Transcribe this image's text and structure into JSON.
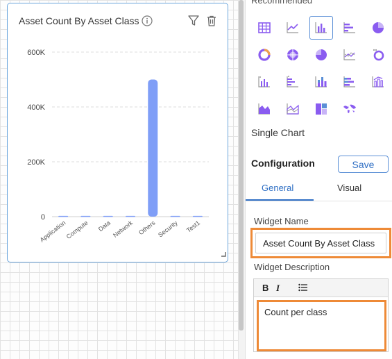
{
  "widget": {
    "title": "Asset Count By Asset Class",
    "icons": [
      "info-icon",
      "filter-icon",
      "trash-icon",
      "resize-icon"
    ]
  },
  "chart_data": {
    "type": "bar",
    "categories": [
      "Application",
      "Compute",
      "Data",
      "Network",
      "Others",
      "Security",
      "Test1"
    ],
    "values": [
      3000,
      3000,
      3000,
      3000,
      500000,
      3000,
      3000
    ],
    "yticks": [
      0,
      200000,
      400000,
      600000
    ],
    "ytick_labels": [
      "0",
      "200K",
      "400K",
      "600K"
    ],
    "ylim": [
      0,
      600000
    ],
    "grid": true,
    "bar_color": "#7f9ef7",
    "title": "",
    "xlabel": "",
    "ylabel": ""
  },
  "panel": {
    "recommended_label": "Recommended",
    "chart_icons": [
      "table-icon",
      "line-chart-icon",
      "bar-chart-icon",
      "horizontal-bar-icon",
      "pie-chart-icon",
      "donut-chart-icon",
      "sunburst-chart-icon",
      "half-pie-icon",
      "multi-line-icon",
      "multi-donut-icon",
      "grouped-bar-icon",
      "grouped-horizontal-bar-icon",
      "stacked-bar-icon",
      "stacked-horizontal-bar-icon",
      "bar-line-combo-icon",
      "area-chart-icon",
      "stacked-area-icon",
      "treemap-icon",
      "world-map-icon"
    ],
    "selected_icon": "bar-chart-icon",
    "single_chart_label": "Single Chart",
    "configuration_label": "Configuration",
    "save_label": "Save",
    "tabs": [
      {
        "label": "General",
        "active": true
      },
      {
        "label": "Visual",
        "active": false
      }
    ],
    "widget_name_label": "Widget Name",
    "widget_name_value": "Asset Count By Asset Class",
    "widget_description_label": "Widget Description",
    "toolbar": {
      "bold": "B",
      "italic": "I"
    },
    "description_value": "Count per class"
  },
  "colors": {
    "accent": "#2f6fc4",
    "highlight": "#ee8a37",
    "widget_border": "#6aa5dc",
    "icon_purple": "#8a5cf0"
  }
}
